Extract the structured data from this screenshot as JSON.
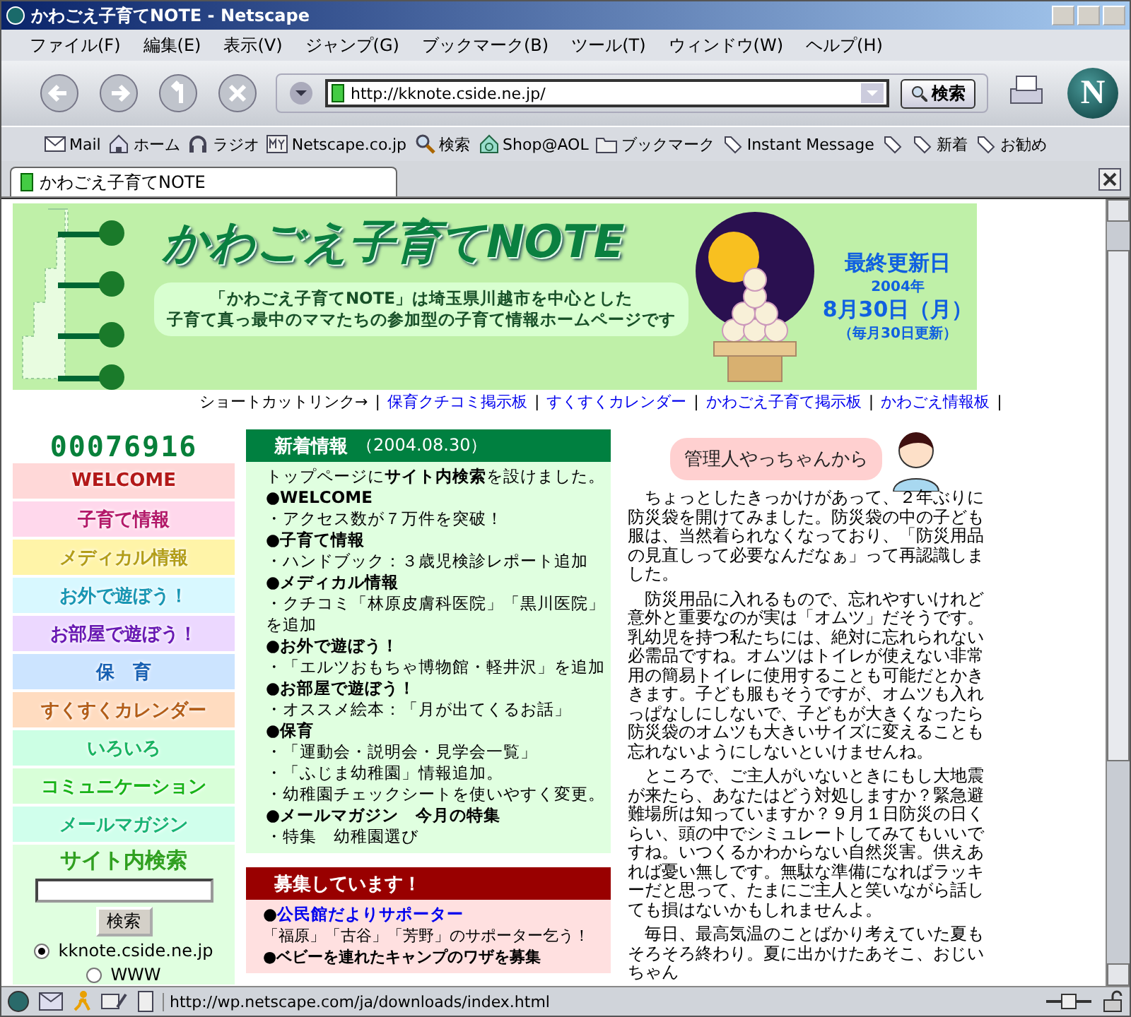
{
  "window": {
    "title": "かわごえ子育てNOTE - Netscape"
  },
  "menu": [
    "ファイル(F)",
    "編集(E)",
    "表示(V)",
    "ジャンプ(G)",
    "ブックマーク(B)",
    "ツール(T)",
    "ウィンドウ(W)",
    "ヘルプ(H)"
  ],
  "address": {
    "value": "http://kknote.cside.ne.jp/"
  },
  "search_button": "検索",
  "logo": "N",
  "personal_toolbar": [
    {
      "label": "Mail"
    },
    {
      "label": "ホーム"
    },
    {
      "label": "ラジオ"
    },
    {
      "label": "Netscape.co.jp"
    },
    {
      "label": "検索"
    },
    {
      "label": "Shop@AOL"
    },
    {
      "label": "ブックマーク"
    },
    {
      "label": "Instant Message"
    },
    {
      "label": "新着"
    },
    {
      "label": "お勧め"
    }
  ],
  "tabs": [
    {
      "label": "かわごえ子育てNOTE",
      "selected": true
    }
  ],
  "banner": {
    "title": "かわごえ子育てNOTE",
    "subtitle": [
      "「かわごえ子育てNOTE」は埼玉県川越市を中心とした",
      "子育て真っ最中のママたちの参加型の子育て情報ホームページです"
    ],
    "updated_label": "最終更新日",
    "year": "2004年",
    "date": "8月30日（月）",
    "note": "（毎月30日更新）"
  },
  "shortcuts": {
    "label": "ショートカットリンク→",
    "links": [
      {
        "separator": "|",
        "text": "保育クチコミ掲示板"
      },
      {
        "separator": "|",
        "text": "すくすくカレンダー"
      },
      {
        "separator": "|",
        "text": "かわごえ子育て掲示板"
      },
      {
        "separator": "|",
        "text": "かわごえ情報板"
      }
    ],
    "end": "|"
  },
  "counter": "00076916",
  "nav": [
    {
      "label": "WELCOME",
      "color": "#ffd8d8"
    },
    {
      "label": "子育て情報",
      "color": "#ffd8ec"
    },
    {
      "label": "メディカル情報",
      "color": "#fff4a8"
    },
    {
      "label": "お外で遊ぼう！",
      "color": "#d8f8ff"
    },
    {
      "label": "お部屋で遊ぼう！",
      "color": "#ecd8ff"
    },
    {
      "label": "保　育",
      "color": "#cce4ff"
    },
    {
      "label": "すくすくカレンダー",
      "color": "#ffdcc0"
    },
    {
      "label": "いろいろ",
      "color": "#ccffe4"
    },
    {
      "label": "コミュニケーション",
      "color": "#d8ffd8"
    },
    {
      "label": "メールマガジン",
      "color": "#d0ffec"
    }
  ],
  "site_search": {
    "title": "サイト内検索",
    "button": "検索",
    "options": [
      {
        "label": "kknote.cside.ne.jp",
        "selected": true
      },
      {
        "label": "WWW",
        "selected": false
      }
    ]
  },
  "news": {
    "title": "新着情報",
    "date": "（2004.08.30）",
    "lines": [
      {
        "kind": "text",
        "text": "トップページに**サイト内検索**を設けました。"
      },
      {
        "kind": "heading",
        "text": "●WELCOME"
      },
      {
        "kind": "item",
        "text": "・アクセス数が７万件を突破！"
      },
      {
        "kind": "heading",
        "text": "●子育て情報"
      },
      {
        "kind": "item",
        "text": "・ハンドブック：３歳児検診レポート追加"
      },
      {
        "kind": "heading",
        "text": "●メディカル情報"
      },
      {
        "kind": "item",
        "text": "・クチコミ「林原皮膚科医院」「黒川医院」を追加"
      },
      {
        "kind": "heading",
        "text": "●お外で遊ぼう！"
      },
      {
        "kind": "item",
        "text": "・「エルツおもちゃ博物館・軽井沢」を追加"
      },
      {
        "kind": "heading",
        "text": "●お部屋で遊ぼう！"
      },
      {
        "kind": "item",
        "text": "・オススメ絵本：「月が出てくるお話」"
      },
      {
        "kind": "heading",
        "text": "●保育"
      },
      {
        "kind": "item",
        "text": "・「運動会・説明会・見学会一覧」"
      },
      {
        "kind": "item",
        "text": "・「ふじま幼稚園」情報追加。"
      },
      {
        "kind": "item",
        "text": "・幼稚園チェックシートを使いやすく変更。"
      },
      {
        "kind": "heading",
        "text": "●メールマガジン　今月の特集"
      },
      {
        "kind": "item",
        "text": "・特集　幼稚園選び"
      }
    ]
  },
  "recruit": {
    "title": "募集しています！",
    "lines": [
      {
        "kind": "link",
        "bullet": "●",
        "text": "公民館だよりサポーター"
      },
      {
        "kind": "item",
        "text": "「福原」「古谷」「芳野」のサポーター乞う！"
      },
      {
        "kind": "heading",
        "text": "●ベビーを連れたキャンプのワザを募集"
      }
    ]
  },
  "message": {
    "title": "管理人やっちゃんから",
    "paragraphs": [
      "ちょっとしたきっかけがあって、２年ぶりに防災袋を開けてみました。防災袋の中の子ども服は、当然着られなくなっており、「防災用品の見直しって必要なんだなぁ」って再認識しました。",
      "防災用品に入れるもので、忘れやすいけれど意外と重要なのが実は「オムツ」だそうです。乳幼児を持つ私たちには、絶対に忘れられない必需品ですね。オムツはトイレが使えない非常用の簡易トイレに使用することも可能だとかききます。子ども服もそうですが、オムツも入れっぱなしにしないで、子どもが大きくなったら防災袋のオムツも大きいサイズに変えることも忘れないようにしないといけませんね。",
      "ところで、ご主人がいないときにもし大地震が来たら、あなたはどう対処しますか？緊急避難場所は知っていますか？９月１日防災の日くらい、頭の中でシミュレートしてみてもいいですね。いつくるかわからない自然災害。供えあれば憂い無しです。無駄な準備になればラッキーだと思って、たまにご主人と笑いながら話しても損はないかもしれませんよ。",
      "毎日、最高気温のことばかり考えていた夏もそろそろ終わり。夏に出かけたあそこ、おじいちゃん"
    ]
  },
  "status_bar": {
    "text": "http://wp.netscape.com/ja/downloads/index.html"
  }
}
